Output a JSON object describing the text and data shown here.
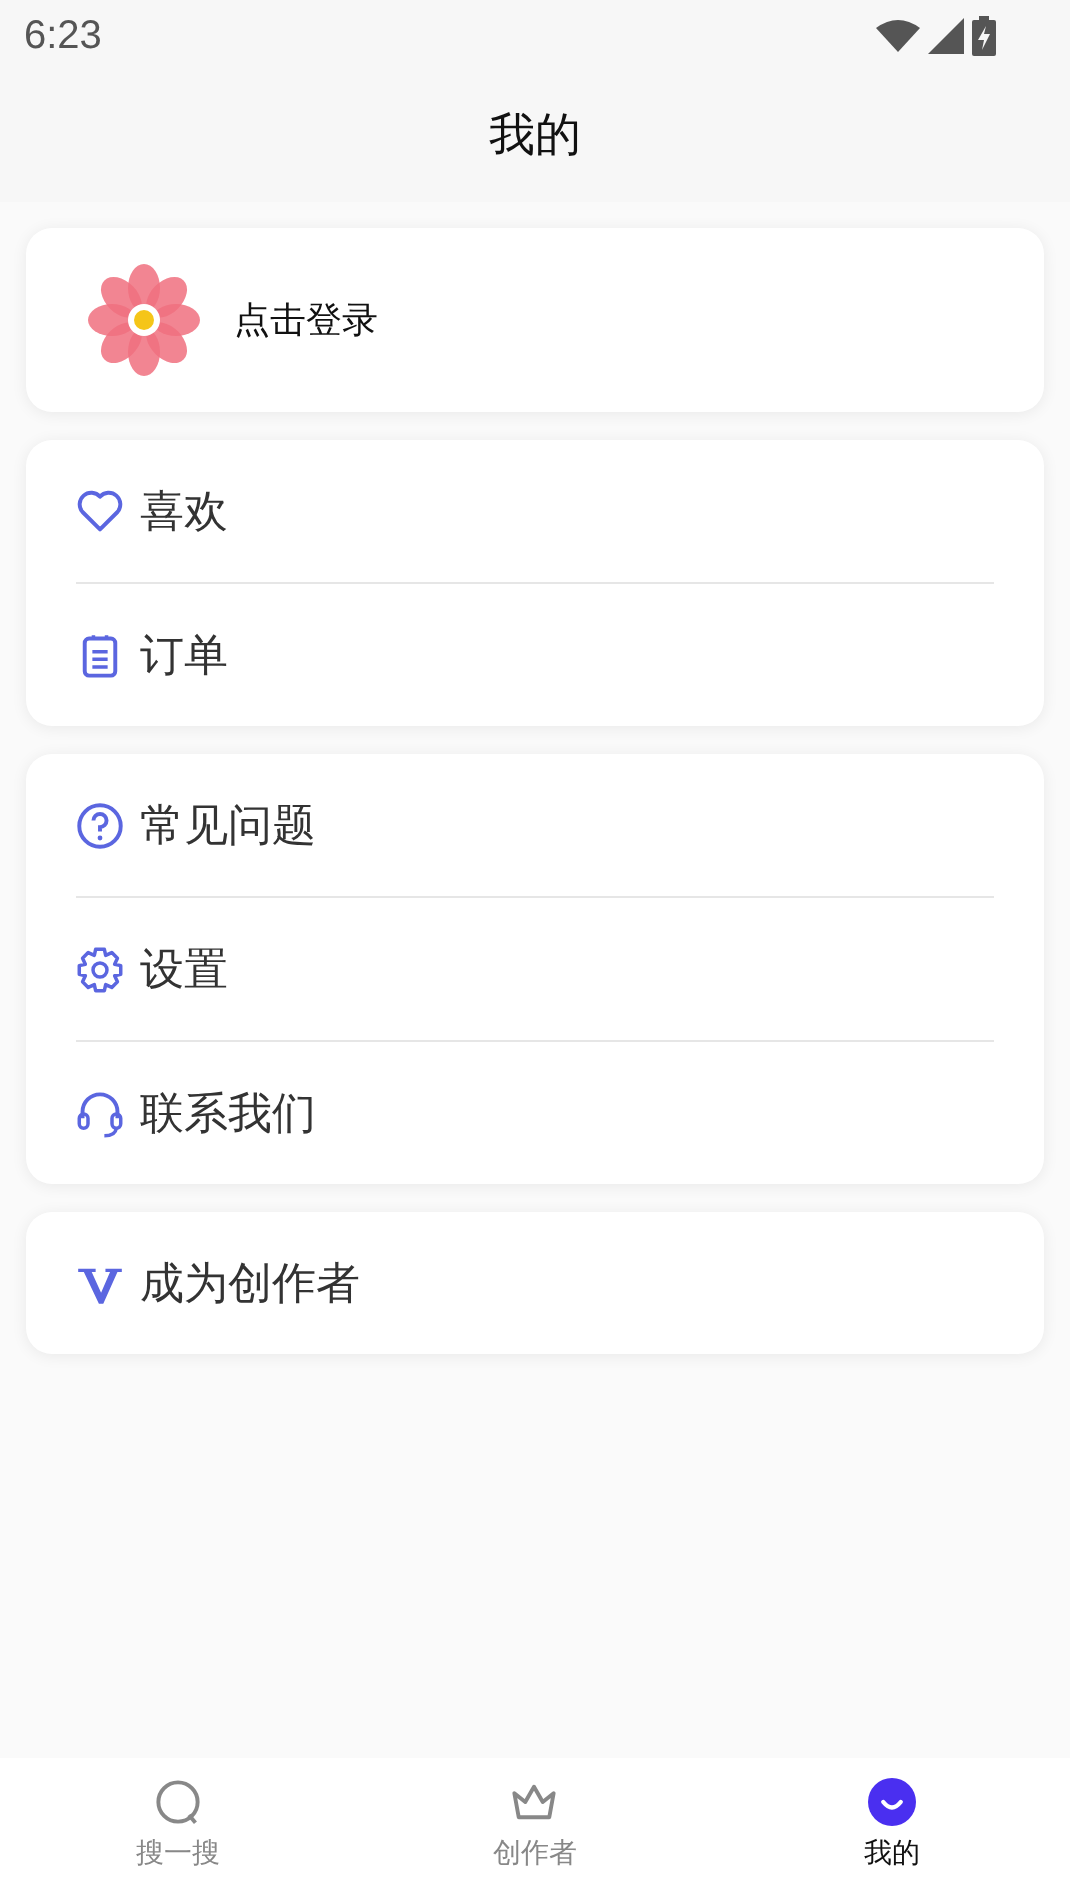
{
  "status_bar": {
    "time": "6:23"
  },
  "header": {
    "title": "我的"
  },
  "login": {
    "label": "点击登录"
  },
  "groups": [
    {
      "items": [
        {
          "label": "喜欢"
        },
        {
          "label": "订单"
        }
      ]
    },
    {
      "items": [
        {
          "label": "常见问题"
        },
        {
          "label": "设置"
        },
        {
          "label": "联系我们"
        }
      ]
    },
    {
      "items": [
        {
          "label": "成为创作者"
        }
      ]
    }
  ],
  "tabs": [
    {
      "label": "搜一搜",
      "selected": false
    },
    {
      "label": "创作者",
      "selected": false
    },
    {
      "label": "我的",
      "selected": true
    }
  ]
}
